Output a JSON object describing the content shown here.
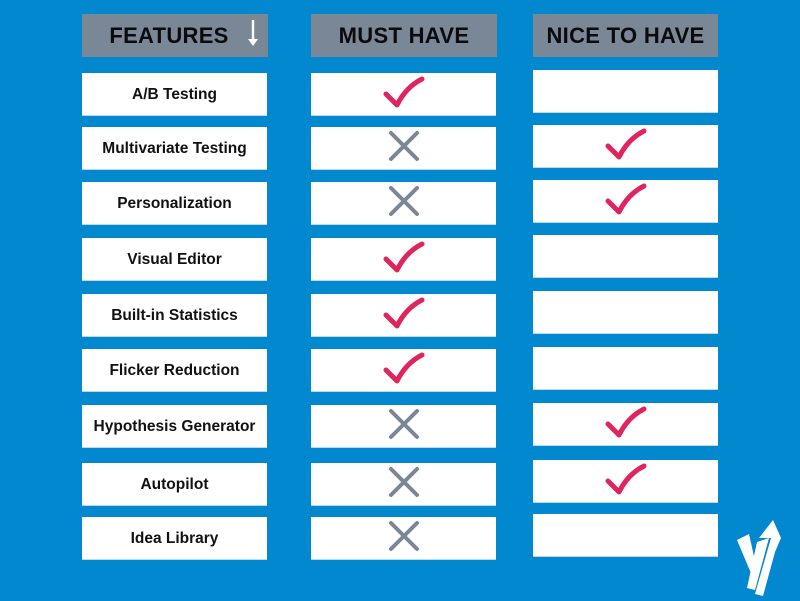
{
  "headers": {
    "features": "FEATURES",
    "must_have": "MUST HAVE",
    "nice_to_have": "NICE TO HAVE"
  },
  "colors": {
    "background": "#0288cf",
    "header_bg": "#7a8797",
    "check": "#e0245e",
    "cross": "#7a8797"
  },
  "rows": [
    {
      "feature": "A/B Testing",
      "must_have": "check",
      "nice_to_have": "none"
    },
    {
      "feature": "Multivariate Testing",
      "must_have": "cross",
      "nice_to_have": "check"
    },
    {
      "feature": "Personalization",
      "must_have": "cross",
      "nice_to_have": "check"
    },
    {
      "feature": "Visual Editor",
      "must_have": "check",
      "nice_to_have": "none"
    },
    {
      "feature": "Built-in Statistics",
      "must_have": "check",
      "nice_to_have": "none"
    },
    {
      "feature": "Flicker Reduction",
      "must_have": "check",
      "nice_to_have": "none"
    },
    {
      "feature": "Hypothesis Generator",
      "must_have": "cross",
      "nice_to_have": "check"
    },
    {
      "feature": "Autopilot",
      "must_have": "cross",
      "nice_to_have": "check"
    },
    {
      "feature": "Idea Library",
      "must_have": "cross",
      "nice_to_have": "none"
    }
  ],
  "icons": {
    "sort": "arrow-down-icon",
    "logo": "brand-logo-icon"
  }
}
